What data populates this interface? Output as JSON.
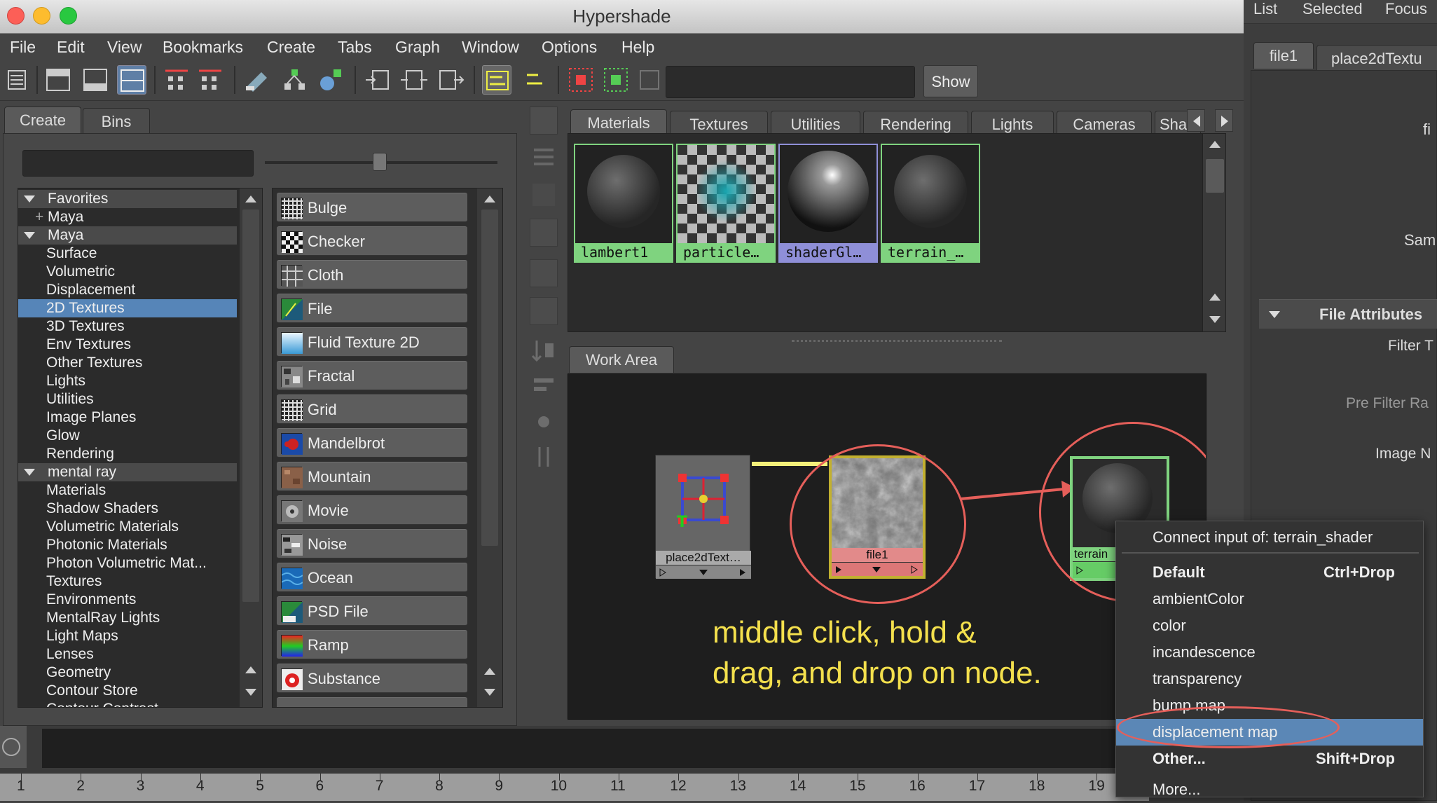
{
  "window": {
    "title": "Hypershade"
  },
  "menu": [
    "File",
    "Edit",
    "View",
    "Bookmarks",
    "Create",
    "Tabs",
    "Graph",
    "Window",
    "Options",
    "Help"
  ],
  "toolbar": {
    "show_label": "Show"
  },
  "left_tabs": {
    "create": "Create",
    "bins": "Bins"
  },
  "tree": [
    {
      "label": "Favorites",
      "kind": "hdr"
    },
    {
      "label": "Maya",
      "kind": "plus"
    },
    {
      "label": "Maya",
      "kind": "hdr"
    },
    {
      "label": "Surface",
      "kind": "item"
    },
    {
      "label": "Volumetric",
      "kind": "item"
    },
    {
      "label": "Displacement",
      "kind": "item"
    },
    {
      "label": "2D Textures",
      "kind": "sel"
    },
    {
      "label": "3D Textures",
      "kind": "item"
    },
    {
      "label": "Env Textures",
      "kind": "item"
    },
    {
      "label": "Other Textures",
      "kind": "item"
    },
    {
      "label": "Lights",
      "kind": "item"
    },
    {
      "label": "Utilities",
      "kind": "item"
    },
    {
      "label": "Image Planes",
      "kind": "item"
    },
    {
      "label": "Glow",
      "kind": "item"
    },
    {
      "label": "Rendering",
      "kind": "item"
    },
    {
      "label": "mental ray",
      "kind": "hdr"
    },
    {
      "label": "Materials",
      "kind": "item"
    },
    {
      "label": "Shadow Shaders",
      "kind": "item"
    },
    {
      "label": "Volumetric Materials",
      "kind": "item"
    },
    {
      "label": "Photonic Materials",
      "kind": "item"
    },
    {
      "label": "Photon Volumetric Mat...",
      "kind": "item"
    },
    {
      "label": "Textures",
      "kind": "item"
    },
    {
      "label": "Environments",
      "kind": "item"
    },
    {
      "label": "MentalRay Lights",
      "kind": "item"
    },
    {
      "label": "Light Maps",
      "kind": "item"
    },
    {
      "label": "Lenses",
      "kind": "item"
    },
    {
      "label": "Geometry",
      "kind": "item"
    },
    {
      "label": "Contour Store",
      "kind": "item"
    },
    {
      "label": "Contour Contrast",
      "kind": "item"
    }
  ],
  "textures": [
    {
      "label": "Bulge",
      "icon": "grid"
    },
    {
      "label": "Checker",
      "icon": "checker"
    },
    {
      "label": "Cloth",
      "icon": "cloth"
    },
    {
      "label": "File",
      "icon": "file"
    },
    {
      "label": "Fluid Texture 2D",
      "icon": "fluid"
    },
    {
      "label": "Fractal",
      "icon": "fractal"
    },
    {
      "label": "Grid",
      "icon": "grid"
    },
    {
      "label": "Mandelbrot",
      "icon": "mandel"
    },
    {
      "label": "Mountain",
      "icon": "mountain"
    },
    {
      "label": "Movie",
      "icon": "movie"
    },
    {
      "label": "Noise",
      "icon": "noise"
    },
    {
      "label": "Ocean",
      "icon": "ocean"
    },
    {
      "label": "PSD File",
      "icon": "psd"
    },
    {
      "label": "Ramp",
      "icon": "ramp"
    },
    {
      "label": "Substance",
      "icon": "substance"
    }
  ],
  "material_tabs": [
    "Materials",
    "Textures",
    "Utilities",
    "Rendering",
    "Lights",
    "Cameras",
    "Sha"
  ],
  "swatches": [
    {
      "label": "lambert1",
      "style": "sphere",
      "color": "#7fd37f"
    },
    {
      "label": "particle…",
      "style": "checker",
      "color": "#7fd37f"
    },
    {
      "label": "shaderGl…",
      "style": "glossy",
      "color": "#8f8fd8"
    },
    {
      "label": "terrain_…",
      "style": "sphere",
      "color": "#7fd37f"
    }
  ],
  "work_area": {
    "tab": "Work Area"
  },
  "nodes": {
    "place2d": "place2dText…",
    "file1": "file1",
    "terrain": "terrain"
  },
  "annotation": {
    "line1": "middle click, hold &",
    "line2": "drag, and drop on node."
  },
  "context_menu": {
    "header": "Connect input of: terrain_shader",
    "items": [
      {
        "label": "Default",
        "shortcut": "Ctrl+Drop",
        "bold": true
      },
      {
        "label": "ambientColor",
        "shortcut": ""
      },
      {
        "label": "color",
        "shortcut": ""
      },
      {
        "label": "incandescence",
        "shortcut": ""
      },
      {
        "label": "transparency",
        "shortcut": ""
      },
      {
        "label": "bump map",
        "shortcut": ""
      },
      {
        "label": "displacement map",
        "shortcut": "",
        "highlight": true
      },
      {
        "label": "Other...",
        "shortcut": "Shift+Drop",
        "bold": true
      },
      {
        "label": "More...",
        "shortcut": ""
      }
    ]
  },
  "right_panel": {
    "menu": [
      "List",
      "Selected",
      "Focus"
    ],
    "tabs": [
      "file1",
      "place2dTextu"
    ],
    "fi": "fi",
    "sam": "Sam",
    "section": "File Attributes",
    "filter": "Filter T",
    "prefilter": "Pre Filter Ra",
    "imagename": "Image N"
  },
  "timeline": [
    "1",
    "2",
    "3",
    "4",
    "5",
    "6",
    "7",
    "8",
    "9",
    "10",
    "11",
    "12",
    "13",
    "14",
    "15",
    "16",
    "17",
    "18",
    "19"
  ],
  "colors": {
    "accent": "#5685b8",
    "swatch_green": "#7fd37f",
    "annotation": "#f4e04d",
    "circle": "#e55f5a"
  }
}
